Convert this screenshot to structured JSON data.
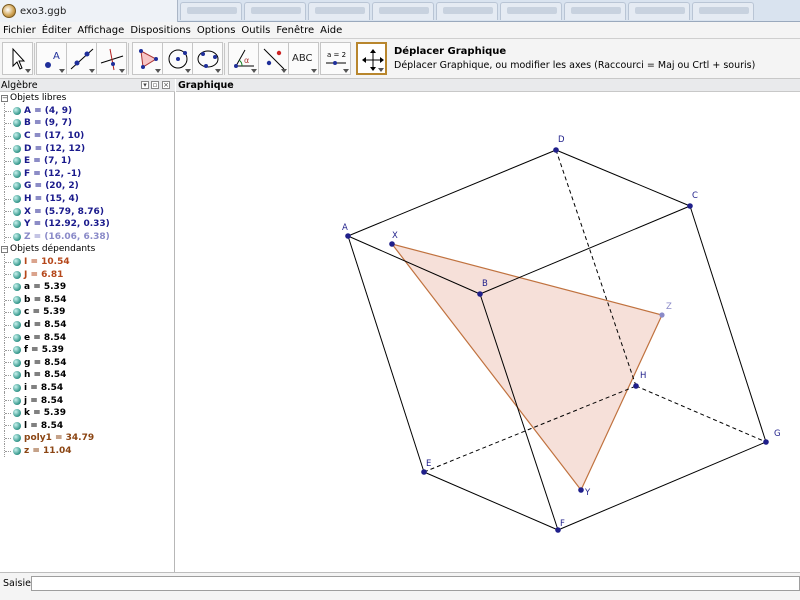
{
  "window": {
    "title": "exo3.ggb"
  },
  "menu": [
    "Fichier",
    "Éditer",
    "Affichage",
    "Dispositions",
    "Options",
    "Outils",
    "Fenêtre",
    "Aide"
  ],
  "toolbar": {
    "tools": [
      {
        "name": "move-tool",
        "icon": "arrow-pointer-icon"
      },
      {
        "name": "point-tool",
        "icon": "point-a-icon",
        "label": "A"
      },
      {
        "name": "line-tool",
        "icon": "line-through-two-points-icon"
      },
      {
        "name": "perpendicular-tool",
        "icon": "perpendicular-line-icon"
      },
      {
        "name": "polygon-tool",
        "icon": "polygon-icon"
      },
      {
        "name": "circle-tool",
        "icon": "circle-center-point-icon"
      },
      {
        "name": "circle-three-points-tool",
        "icon": "circle-three-points-icon"
      },
      {
        "name": "angle-tool",
        "icon": "angle-icon",
        "label": "α"
      },
      {
        "name": "reflect-tool",
        "icon": "reflect-about-line-icon"
      },
      {
        "name": "text-tool",
        "icon": "text-icon",
        "label": "ABC"
      },
      {
        "name": "slider-tool",
        "icon": "slider-icon",
        "label": "a = 2"
      },
      {
        "name": "move-graphics-tool",
        "icon": "move-graphics-icon"
      }
    ],
    "active_tool_title": "Déplacer Graphique",
    "active_tool_help": "Déplacer Graphique, ou modifier les axes (Raccourci = Maj ou Crtl + souris)"
  },
  "algebra": {
    "header": "Algèbre",
    "free_label": "Objets libres",
    "free_items": [
      {
        "text": "A = (4, 9)",
        "color": "#1a1a8c"
      },
      {
        "text": "B = (9, 7)",
        "color": "#1a1a8c"
      },
      {
        "text": "C = (17, 10)",
        "color": "#1a1a8c"
      },
      {
        "text": "D = (12, 12)",
        "color": "#1a1a8c"
      },
      {
        "text": "E = (7, 1)",
        "color": "#1a1a8c"
      },
      {
        "text": "F = (12, -1)",
        "color": "#1a1a8c"
      },
      {
        "text": "G = (20, 2)",
        "color": "#1a1a8c"
      },
      {
        "text": "H = (15, 4)",
        "color": "#1a1a8c"
      },
      {
        "text": "X = (5.79, 8.76)",
        "color": "#1a1a8c"
      },
      {
        "text": "Y = (12.92, 0.33)",
        "color": "#1a1a8c"
      },
      {
        "text": "Z = (16.06, 6.38)",
        "color": "#8a8ac8"
      }
    ],
    "dependent_label": "Objets dépendants",
    "dependent_items": [
      {
        "text": "I = 10.54",
        "color": "#b5471a"
      },
      {
        "text": "J = 6.81",
        "color": "#b5471a"
      },
      {
        "text": "a = 5.39",
        "color": "#000000"
      },
      {
        "text": "b = 8.54",
        "color": "#000000"
      },
      {
        "text": "c = 5.39",
        "color": "#000000"
      },
      {
        "text": "d = 8.54",
        "color": "#000000"
      },
      {
        "text": "e = 8.54",
        "color": "#000000"
      },
      {
        "text": "f = 5.39",
        "color": "#000000"
      },
      {
        "text": "g = 8.54",
        "color": "#000000"
      },
      {
        "text": "h = 8.54",
        "color": "#000000"
      },
      {
        "text": "i = 8.54",
        "color": "#000000"
      },
      {
        "text": "j = 8.54",
        "color": "#000000"
      },
      {
        "text": "k = 5.39",
        "color": "#000000"
      },
      {
        "text": "l = 8.54",
        "color": "#000000"
      },
      {
        "text": "poly1 = 34.79",
        "color": "#8b4513"
      },
      {
        "text": "z = 11.04",
        "color": "#8b4513"
      }
    ]
  },
  "graphics": {
    "header": "Graphique",
    "point_color": "#1f1f8a",
    "triangle_fill": "#f3d6cc",
    "triangle_stroke": "#c0723f"
  },
  "input": {
    "label": "Saisie:",
    "value": ""
  }
}
